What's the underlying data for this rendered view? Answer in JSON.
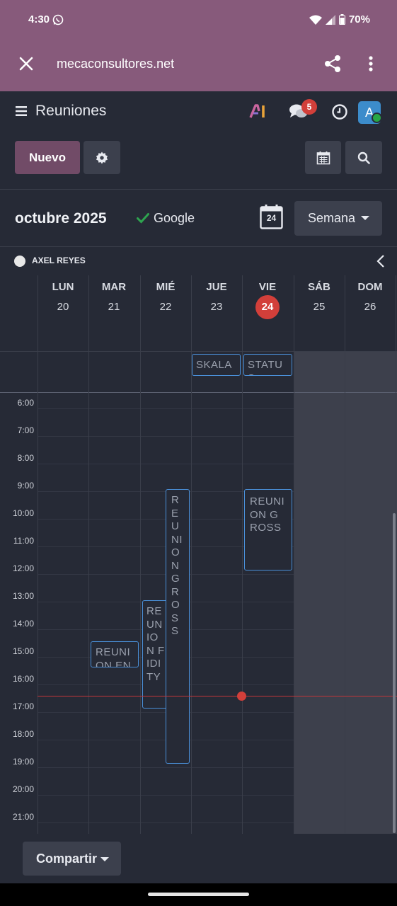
{
  "status_bar": {
    "time": "4:30",
    "battery": "70%",
    "icons": [
      "whatsapp-icon",
      "wifi-icon",
      "signal-icon",
      "battery-icon"
    ]
  },
  "browser": {
    "url": "mecaconsultores.net",
    "icons": [
      "close-icon",
      "share-icon",
      "more-vert-icon"
    ]
  },
  "app": {
    "title": "Reuniones",
    "notifications": "5",
    "avatar_letter": "A",
    "new_label": "Nuevo"
  },
  "period": {
    "label": "octubre 2025",
    "google_label": "Google",
    "today_number": "24",
    "view_label": "Semana"
  },
  "attendee": {
    "name": "AXEL REYES"
  },
  "days": [
    {
      "name": "LUN",
      "date": "20",
      "today": false
    },
    {
      "name": "MAR",
      "date": "21",
      "today": false
    },
    {
      "name": "MIÉ",
      "date": "22",
      "today": false
    },
    {
      "name": "JUE",
      "date": "23",
      "today": false
    },
    {
      "name": "VIE",
      "date": "24",
      "today": true
    },
    {
      "name": "SÁB",
      "date": "25",
      "today": false
    },
    {
      "name": "DOM",
      "date": "26",
      "today": false
    }
  ],
  "hours": [
    "6:00",
    "7:00",
    "8:00",
    "9:00",
    "10:00",
    "11:00",
    "12:00",
    "13:00",
    "14:00",
    "15:00",
    "16:00",
    "17:00",
    "18:00",
    "19:00",
    "20:00",
    "21:00"
  ],
  "all_day_events": [
    {
      "title": "SKALA",
      "day": "23"
    },
    {
      "title": "STATUS",
      "day": "24"
    }
  ],
  "events": [
    {
      "title": "REUNION GROSS",
      "day": "22"
    },
    {
      "title": "REUNION FIDITY",
      "day": "22"
    },
    {
      "title": "REUNION EN",
      "day": "21"
    },
    {
      "title": "REUNION GROSS",
      "day": "24"
    }
  ],
  "footer": {
    "share_label": "Compartir"
  },
  "colors": {
    "brand": "#875a7b",
    "primary_button": "#714b67",
    "today": "#d23f3a",
    "event_border": "#4a90d9",
    "background": "#262a36"
  }
}
